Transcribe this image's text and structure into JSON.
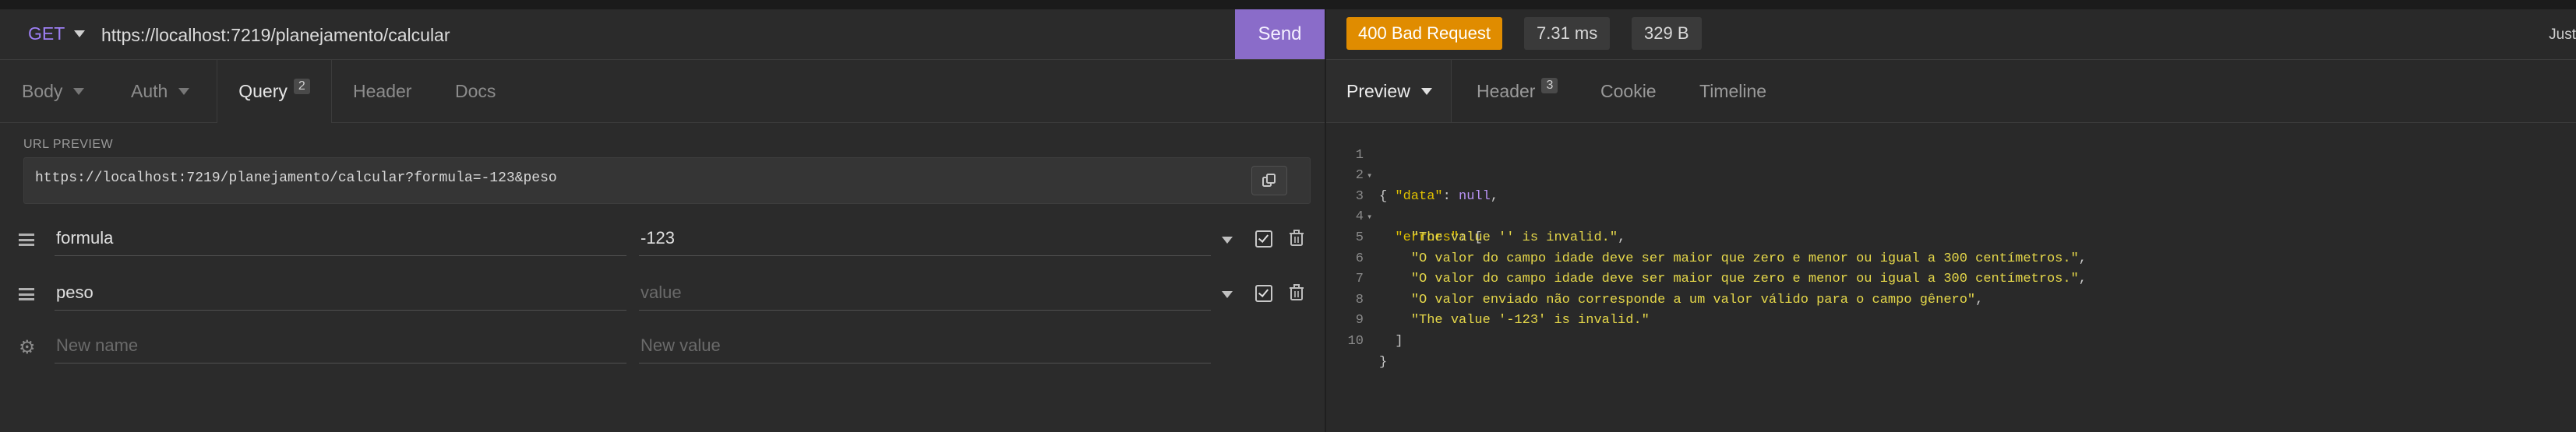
{
  "request": {
    "method": "GET",
    "url": "https://localhost:7219/planejamento/calcular",
    "send_label": "Send"
  },
  "request_tabs": [
    {
      "label": "Body"
    },
    {
      "label": "Auth"
    },
    {
      "label": "Query",
      "badge": "2"
    },
    {
      "label": "Header"
    },
    {
      "label": "Docs"
    }
  ],
  "url_preview": {
    "label": "URL PREVIEW",
    "value": "https://localhost:7219/planejamento/calcular?formula=-123&peso"
  },
  "params": [
    {
      "name": "formula",
      "value": "-123",
      "value_placeholder": "value"
    },
    {
      "name": "peso",
      "value": "",
      "value_placeholder": "value"
    }
  ],
  "new_param": {
    "name_placeholder": "New name",
    "value_placeholder": "New value"
  },
  "response": {
    "status": "400 Bad Request",
    "time": "7.31 ms",
    "size": "329 B",
    "timestamp": "Just",
    "tabs": [
      {
        "label": "Preview"
      },
      {
        "label": "Header",
        "badge": "3"
      },
      {
        "label": "Cookie"
      },
      {
        "label": "Timeline"
      }
    ],
    "line_numbers": [
      "1",
      "2",
      "3",
      "4",
      "5",
      "6",
      "7",
      "8",
      "9",
      "10"
    ],
    "body": {
      "open": "{",
      "data_key": "\"data\"",
      "data_value": "null",
      "errors_key": "\"errors\"",
      "errors": [
        "\"The value '' is invalid.\"",
        "\"O valor do campo idade deve ser maior que zero e menor ou igual a 300 centímetros.\"",
        "\"O valor do campo idade deve ser maior que zero e menor ou igual a 300 centímetros.\"",
        "\"O valor enviado não corresponde a um valor válido para o campo gênero\"",
        "\"The value '-123' is invalid.\""
      ],
      "array_close": "]",
      "close": "}"
    }
  },
  "colors": {
    "accent": "#8a6cc9",
    "method": "#9d7ff4",
    "status_badge": "#e08c00",
    "json_string": "#e6d84a",
    "json_null": "#b993f5"
  }
}
